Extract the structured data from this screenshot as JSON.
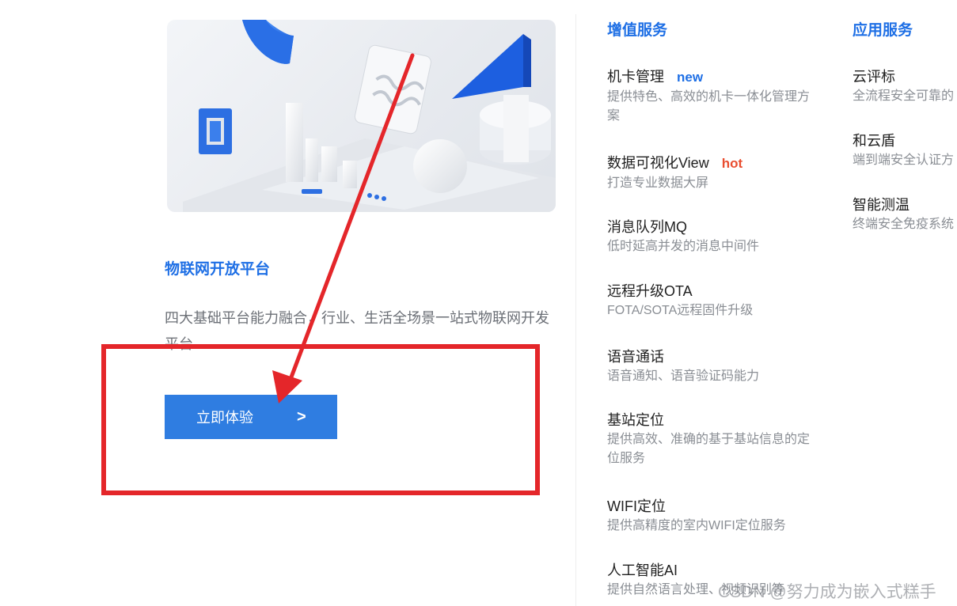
{
  "platform": {
    "title": "物联网开放平台",
    "description": "四大基础平台能力融合，行业、生活全场景一站式物联网开发平台",
    "cta_label": "立即体验",
    "cta_arrow": ">"
  },
  "value_added": {
    "header": "增值服务",
    "items": [
      {
        "name": "机卡管理",
        "tag": "new",
        "desc": "提供特色、高效的机卡一体化管理方案"
      },
      {
        "name": "数据可视化View",
        "tag": "hot",
        "desc": "打造专业数据大屏"
      },
      {
        "name": "消息队列MQ",
        "desc": "低时延高并发的消息中间件"
      },
      {
        "name": "远程升级OTA",
        "desc": "FOTA/SOTA远程固件升级"
      },
      {
        "name": "语音通话",
        "desc": "语音通知、语音验证码能力"
      },
      {
        "name": "基站定位",
        "desc": "提供高效、准确的基于基站信息的定位服务"
      },
      {
        "name": "WIFI定位",
        "desc": "提供高精度的室内WIFI定位服务"
      },
      {
        "name": "人工智能AI",
        "desc": "提供自然语言处理、视频识别等"
      }
    ]
  },
  "app_services": {
    "header": "应用服务",
    "items": [
      {
        "name": "云评标",
        "desc": "全流程安全可靠的"
      },
      {
        "name": "和云盾",
        "desc": "端到端安全认证方"
      },
      {
        "name": "智能测温",
        "desc": "终端安全免疫系统"
      }
    ]
  },
  "watermark": "CSDN @努力成为嵌入式糕手",
  "colors": {
    "accent": "#1e6fe5",
    "button": "#2f7de1",
    "annotation": "#e4262a",
    "hot": "#e94d2f"
  }
}
